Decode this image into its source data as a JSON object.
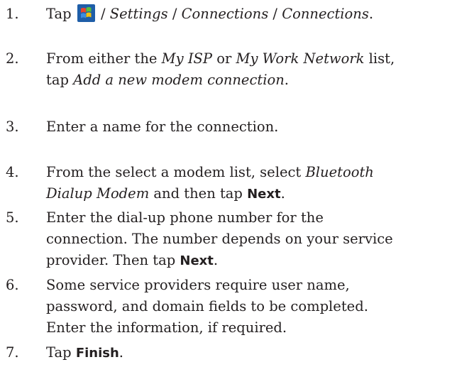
{
  "steps": [
    {
      "num": "1.",
      "lines": [
        {
          "parts": [
            {
              "t": "Tap ",
              "s": "n"
            },
            {
              "icon": "windows-start-icon"
            },
            {
              "t": " / ",
              "s": "n"
            },
            {
              "t": "Settings",
              "s": "i"
            },
            {
              "t": " / ",
              "s": "n"
            },
            {
              "t": "Connections",
              "s": "i"
            },
            {
              "t": " / ",
              "s": "n"
            },
            {
              "t": "Connections",
              "s": "i"
            },
            {
              "t": ".",
              "s": "n"
            }
          ]
        }
      ]
    },
    {
      "num": "2.",
      "lines": [
        {
          "parts": [
            {
              "t": "From either the ",
              "s": "n"
            },
            {
              "t": "My ISP",
              "s": "i"
            },
            {
              "t": " or ",
              "s": "n"
            },
            {
              "t": "My Work Network",
              "s": "i"
            },
            {
              "t": " list,",
              "s": "n"
            }
          ]
        },
        {
          "parts": [
            {
              "t": "tap ",
              "s": "n"
            },
            {
              "t": "Add a new modem connection",
              "s": "i"
            },
            {
              "t": ".",
              "s": "n"
            }
          ]
        }
      ]
    },
    {
      "num": "3.",
      "lines": [
        {
          "parts": [
            {
              "t": "Enter a name for the connection.",
              "s": "n"
            }
          ]
        }
      ]
    },
    {
      "num": "4.",
      "lines": [
        {
          "parts": [
            {
              "t": "From the select a modem list, select ",
              "s": "n"
            },
            {
              "t": "Bluetooth",
              "s": "i"
            }
          ]
        },
        {
          "parts": [
            {
              "t": "Dialup Modem",
              "s": "i"
            },
            {
              "t": " and then tap ",
              "s": "n"
            },
            {
              "t": "Next",
              "s": "b"
            },
            {
              "t": ".",
              "s": "n"
            }
          ]
        }
      ]
    },
    {
      "num": "5.",
      "lines": [
        {
          "parts": [
            {
              "t": "Enter the dial-up phone number for the",
              "s": "n"
            }
          ]
        },
        {
          "parts": [
            {
              "t": "connection. The number depends on your service",
              "s": "n"
            }
          ]
        },
        {
          "parts": [
            {
              "t": "provider. Then tap ",
              "s": "n"
            },
            {
              "t": "Next",
              "s": "b"
            },
            {
              "t": ".",
              "s": "n"
            }
          ]
        }
      ]
    },
    {
      "num": "6.",
      "lines": [
        {
          "parts": [
            {
              "t": "Some service providers require user name,",
              "s": "n"
            }
          ]
        },
        {
          "parts": [
            {
              "t": "password, and domain fields to be completed.",
              "s": "n"
            }
          ]
        },
        {
          "parts": [
            {
              "t": "Enter the information, if required.",
              "s": "n"
            }
          ]
        }
      ]
    },
    {
      "num": "7.",
      "lines": [
        {
          "parts": [
            {
              "t": "Tap ",
              "s": "n"
            },
            {
              "t": "Finish",
              "s": "b"
            },
            {
              "t": ".",
              "s": "n"
            }
          ]
        }
      ]
    }
  ],
  "colors": {
    "text": "#231f20",
    "icon_bg": "#1f5ea8",
    "flag_red": "#e8452c",
    "flag_green": "#5bbf3a",
    "flag_blue": "#3c8de0",
    "flag_yellow": "#f4c20d"
  }
}
